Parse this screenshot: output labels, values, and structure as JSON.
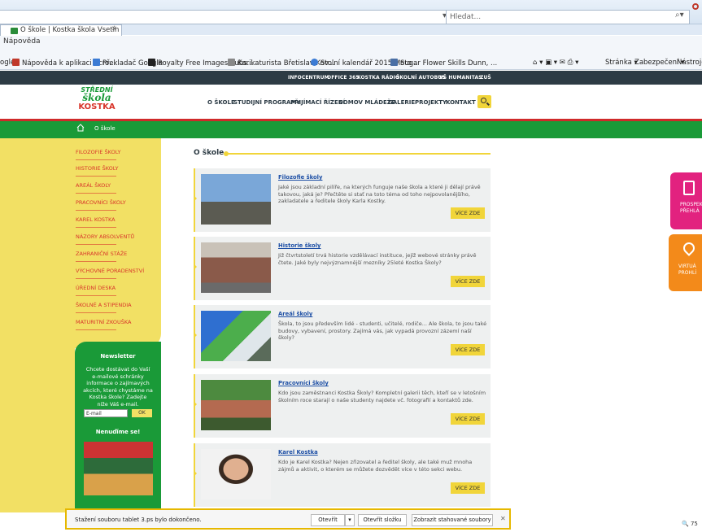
{
  "browser": {
    "search_placeholder": "Hledat...",
    "tab_title": "O škole | Kostka škola Vsetín",
    "menu_help": "Nápověda",
    "favorites": [
      {
        "label": "ogle"
      },
      {
        "label": "Nápověda k aplikaci Acro..."
      },
      {
        "label": "Překladač Google"
      },
      {
        "label": "Royalty Free Images Subs..."
      },
      {
        "label": "Karikaturista Břetislav Kov..."
      },
      {
        "label": "Stolní kalendář 2015 Moto..."
      },
      {
        "label": "Sugar Flower Skills Dunn, ..."
      }
    ],
    "tools": {
      "page": "Stránka",
      "security": "Zabezpečení",
      "tools": "Nástroje"
    }
  },
  "topbar": [
    "INFOCENTRUM",
    "OFFICE 365",
    "KOSTKA RÁDIO",
    "ŠKOLNÍ AUTOBUS",
    "VŠ HUMANITAS",
    "ZUŠ"
  ],
  "logo": {
    "line1": "STŘEDNÍ",
    "line2": "škola",
    "line3": "KOSTKA"
  },
  "nav": [
    "O ŠKOLE",
    "STUDIJNÍ PROGRAMY",
    "PŘIJÍMACÍ ŘÍZENÍ",
    "DOMOV MLÁDEŽE",
    "GALERIE",
    "PROJEKTY",
    "KONTAKT"
  ],
  "breadcrumb": "O škole",
  "sidebar": [
    "FILOZOFIE ŠKOLY",
    "HISTORIE ŠKOLY",
    "AREÁL ŠKOLY",
    "PRACOVNÍCI ŠKOLY",
    "KAREL KOSTKA",
    "NÁZORY ABSOLVENTŮ",
    "ZAHRANIČNÍ STÁŽE",
    "VÝCHOVNÉ PORADENSTVÍ",
    "ÚŘEDNÍ DESKA",
    "ŠKOLNÉ A STIPENDIA",
    "MATURITNÍ ZKOUŠKA"
  ],
  "newsletter": {
    "title": "Newsletter",
    "text": "Chcete dostávat do Vaší e-mailové schránky informace o zajímavých akcích, které chystáme na Kostka škole? Zadejte níže Váš e-mail.",
    "placeholder": "E-mail",
    "ok": "OK",
    "miss": "Nenuďíme se!"
  },
  "content": {
    "title": "O škole",
    "more_label": "VÍCE ZDE",
    "cards": [
      {
        "title": "Filozofie školy",
        "text": "Jaké jsou základní pilíře, na kterých funguje naše škola a které ji dělají právě takovou, jaká je? Přečtěte si stať na toto téma od toho nejpovolanějšího, zakladatele a ředitele školy Karla Kostky."
      },
      {
        "title": "Historie školy",
        "text": "Již čtvrtstoletí trvá historie vzdělávací instituce, jejíž webové stránky právě čtete. Jaké byly nejvýznamnější mezníky 25leté Kostka Školy?"
      },
      {
        "title": "Areál školy",
        "text": "Škola, to jsou především lidé - studenti, učitelé, rodiče... Ale škola, to jsou také budovy, vybavení, prostory. Zajímá vás, jak vypadá provozní zázemí naší školy?"
      },
      {
        "title": "Pracovníci školy",
        "text": "Kdo jsou zaměstnanci Kostka Školy? Kompletní galerii těch, kteří se v letošním školním roce starají o naše studenty najdete vč. fotografií a kontaktů zde."
      },
      {
        "title": "Karel Kostka",
        "text": "Kdo je Karel Kostka? Nejen zřizovatel a ředitel školy, ale také muž mnoha zájmů a aktivit, o kterém se můžete dozvědět více v této sekci webu."
      }
    ]
  },
  "promos": [
    {
      "line1": "PROSPEKT",
      "line2": "PŘEHLÁ"
    },
    {
      "line1": "VIRTUÁ",
      "line2": "PROHLÍ"
    }
  ],
  "download": {
    "text": "Stažení souboru tablet 3.ps bylo dokončeno.",
    "open": "Otevřít",
    "open_folder": "Otevřít složku",
    "show": "Zobrazit stahované soubory"
  },
  "zoom": "75"
}
